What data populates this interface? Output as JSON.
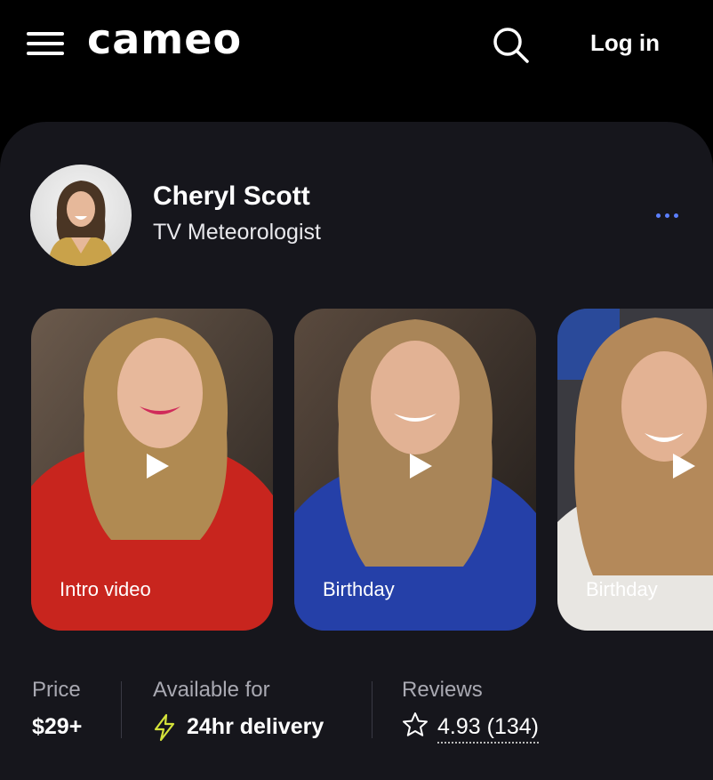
{
  "header": {
    "logo": "cameo",
    "login_label": "Log in"
  },
  "profile": {
    "name": "Cheryl Scott",
    "title": "TV Meteorologist"
  },
  "videos": [
    {
      "label": "Intro video"
    },
    {
      "label": "Birthday"
    },
    {
      "label": "Birthday"
    }
  ],
  "stats": {
    "price_label": "Price",
    "price_value": "$29+",
    "availability_label": "Available for",
    "availability_value": "24hr delivery",
    "reviews_label": "Reviews",
    "rating": "4.93",
    "review_count": "(134)"
  },
  "colors": {
    "background": "#000000",
    "card": "#16161c",
    "accent": "#5b7fff",
    "bolt": "#d4e23a"
  },
  "icons": [
    "menu-icon",
    "search-icon",
    "more-icon",
    "play-icon",
    "bolt-icon",
    "star-icon"
  ]
}
